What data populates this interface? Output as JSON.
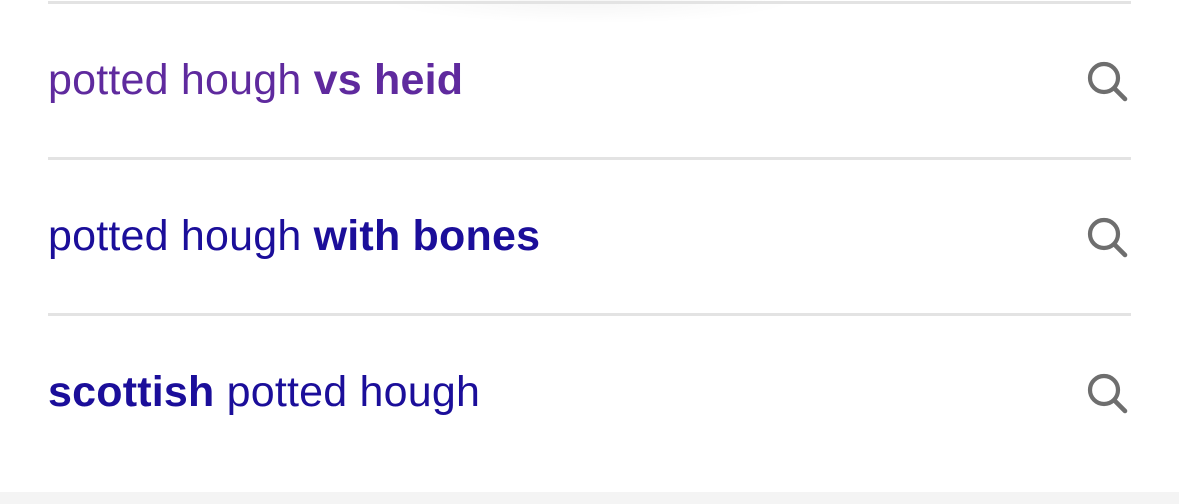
{
  "suggestions": [
    {
      "parts": [
        {
          "text": "potted hough ",
          "bold": false
        },
        {
          "text": "vs heid",
          "bold": true
        }
      ],
      "color": "#5f2a9e",
      "icon": "search-icon"
    },
    {
      "parts": [
        {
          "text": "potted hough ",
          "bold": false
        },
        {
          "text": "with bones",
          "bold": true
        }
      ],
      "color": "#1b0e9a",
      "icon": "search-icon"
    },
    {
      "parts": [
        {
          "text": "scottish",
          "bold": true
        },
        {
          "text": " potted hough",
          "bold": false
        }
      ],
      "color": "#1b0e9a",
      "icon": "search-icon"
    }
  ],
  "colors": {
    "divider": "#e3e3e3",
    "icon": "#6e6e6e",
    "visited_link": "#5f2a9e",
    "link": "#1b0e9a"
  }
}
